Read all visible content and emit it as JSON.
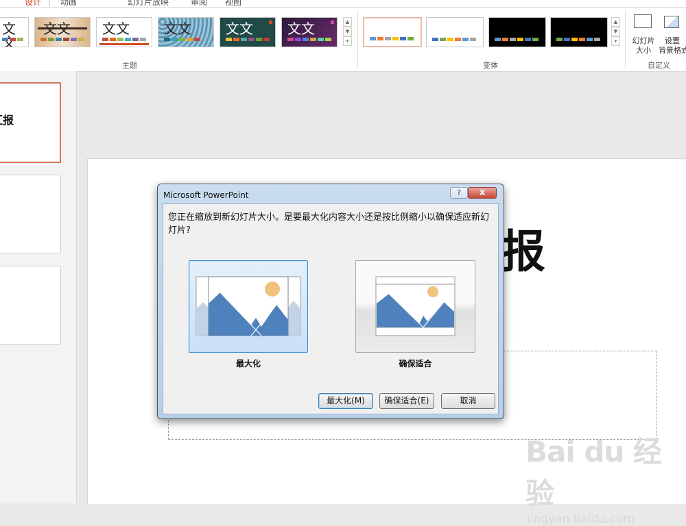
{
  "ribbon_tabs": [
    "设计",
    "动画",
    "幻灯片放映",
    "审阅",
    "视图"
  ],
  "active_tab": "设计",
  "themes": [
    {
      "title": "文文",
      "bg": "#ffffff",
      "color": "#222222"
    },
    {
      "title": "文文",
      "bg": "#e8d2b4",
      "color": "#2a2a2a"
    },
    {
      "title": "文文",
      "bg": "#ffffff",
      "color": "#222222"
    },
    {
      "title": "文文",
      "bg": "#7fb4cc",
      "color": "#1a2a3a"
    },
    {
      "title": "文文",
      "bg": "#1f4a47",
      "color": "#ffffff"
    },
    {
      "title": "文文",
      "bg": "#4a1e52",
      "color": "#ffffff"
    }
  ],
  "variants_count": 4,
  "group_labels": {
    "themes": "主题",
    "variants": "变体",
    "customize": "自定义"
  },
  "customize": {
    "slide_size_label": "幻灯片",
    "slide_size_label2": "大小",
    "format_bg_label": "设置",
    "format_bg_label2": "背景格式"
  },
  "slide_thumb_title_fragment": "汇报",
  "slide": {
    "title_fragment": "报"
  },
  "dialog": {
    "title": "Microsoft PowerPoint",
    "help_glyph": "?",
    "close_glyph": "X",
    "message": "您正在缩放到新幻灯片大小。是要最大化内容大小还是按比例缩小以确保适应新幻灯片?",
    "option_maximize_label": "最大化",
    "option_ensure_fit_label": "确保适合",
    "buttons": {
      "maximize": "最大化(M)",
      "ensure_fit": "确保适合(E)",
      "cancel": "取消"
    }
  },
  "watermark": {
    "logo": "Bai du 经验",
    "url": "jingyan.baidu.com"
  },
  "colors": {
    "accent_orange": "#d04a22",
    "mountain_blue": "#4f81bd",
    "sun": "#f0c27b",
    "selection_blue": "#3c8ccf"
  }
}
